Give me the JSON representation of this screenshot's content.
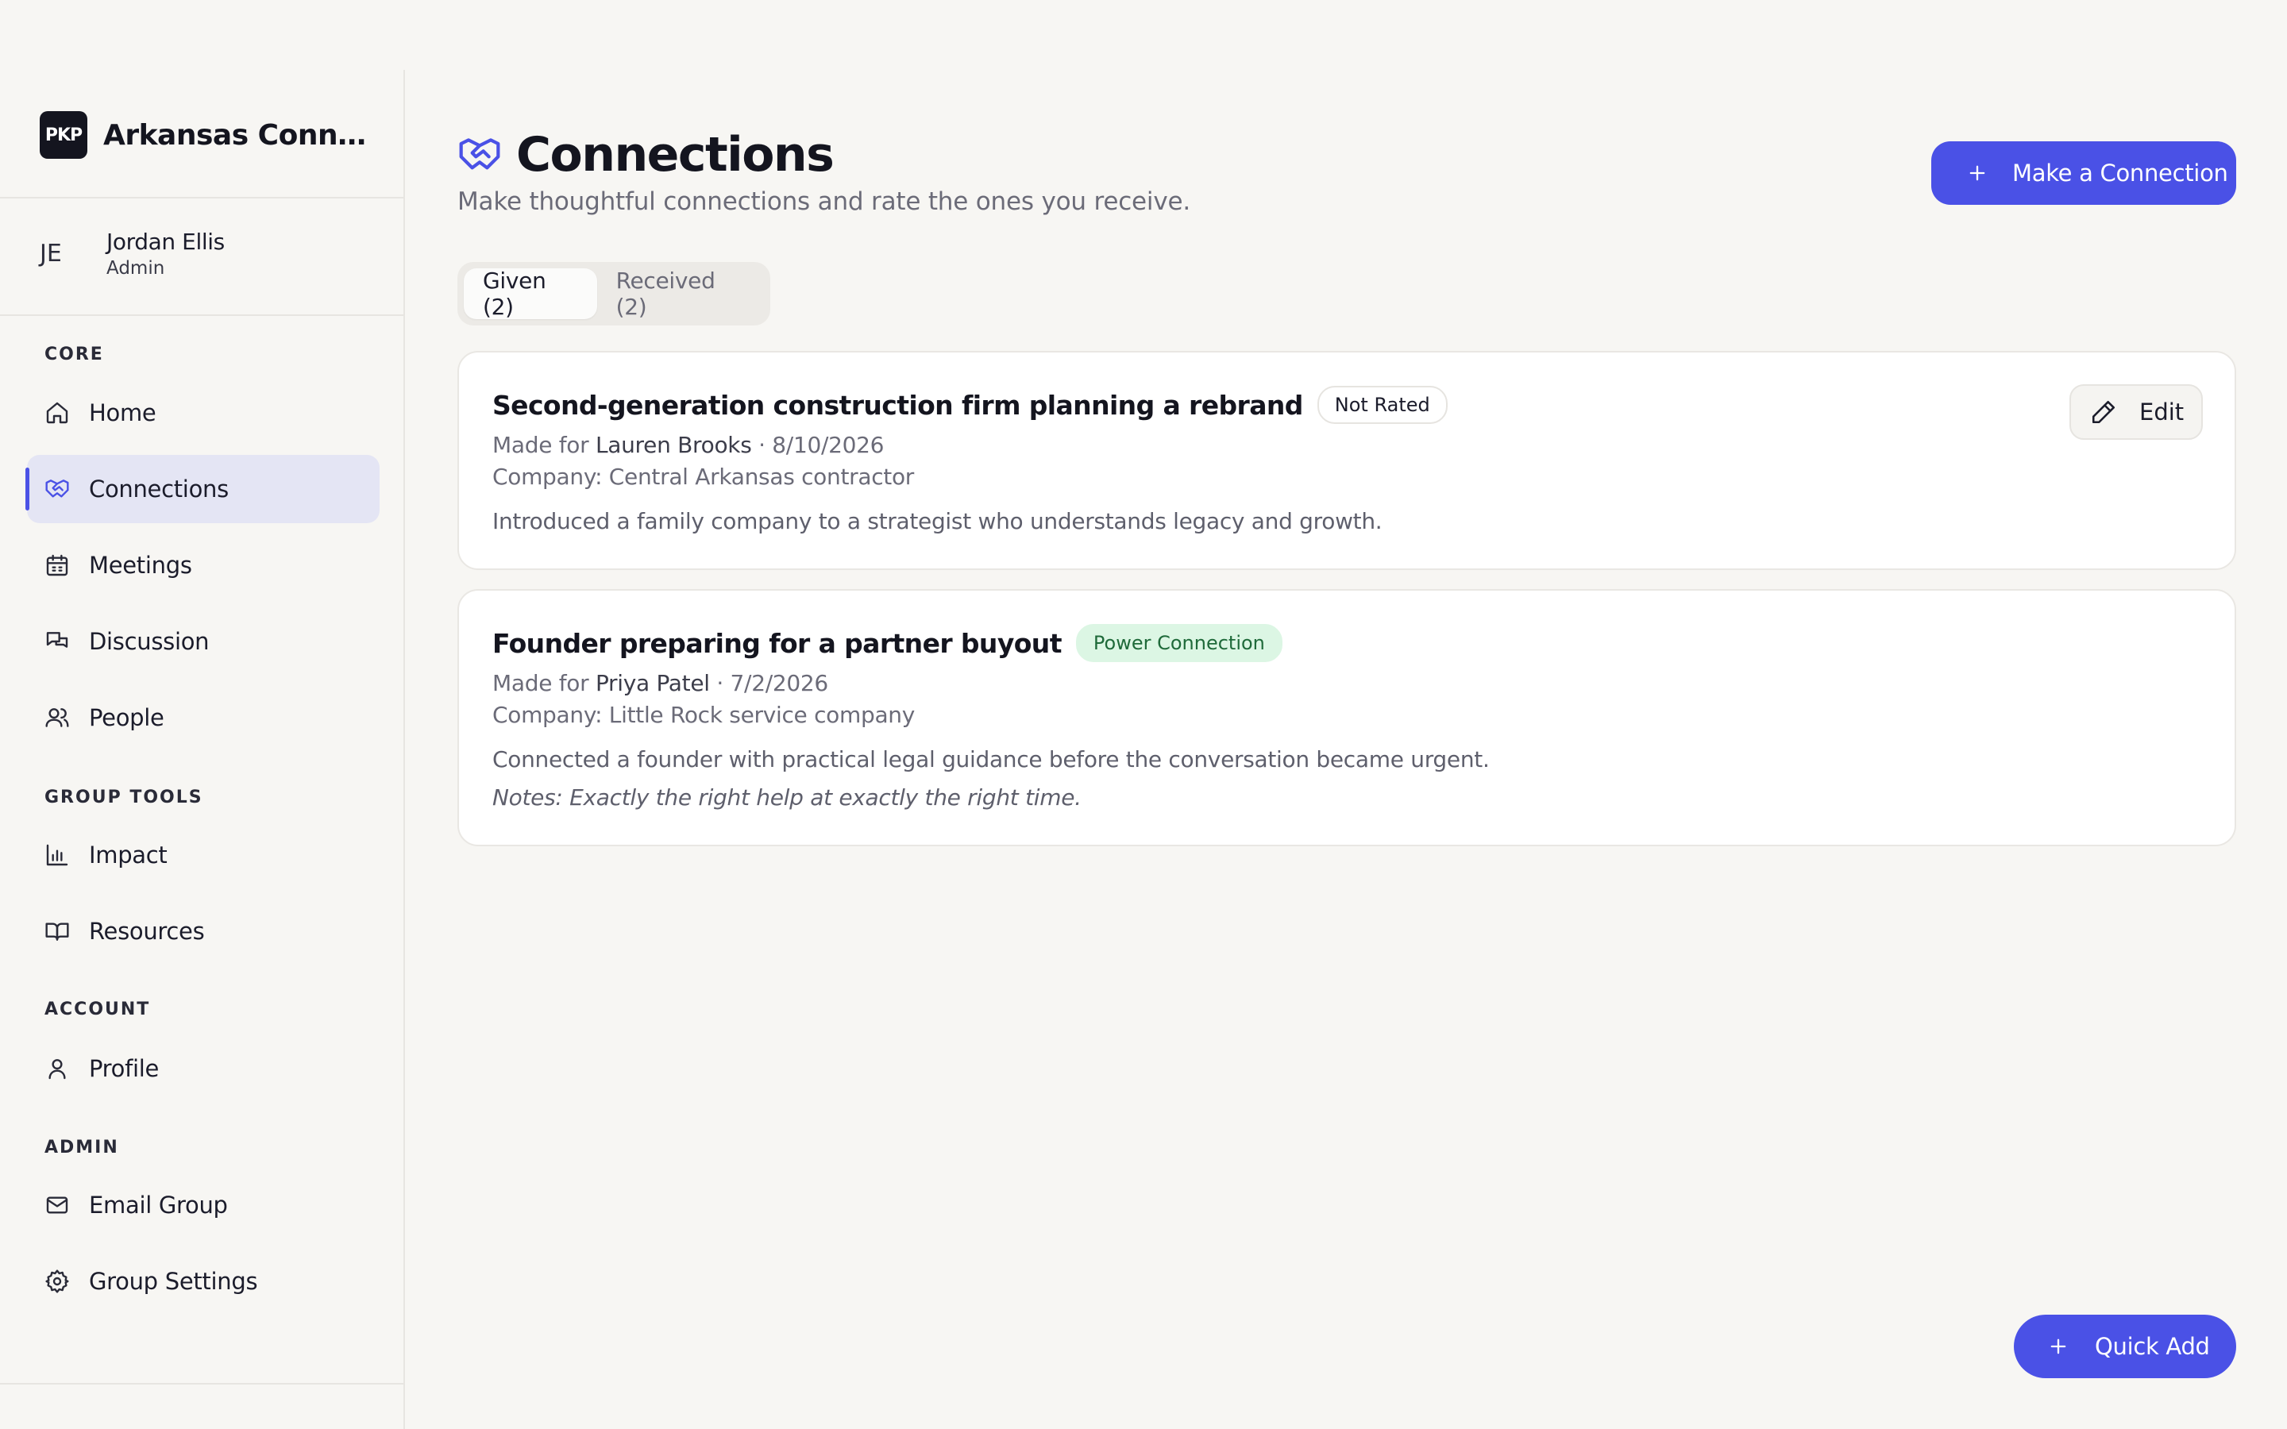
{
  "colors": {
    "accent": "#4a51e6",
    "active_nav_bg": "#e4e5f4",
    "power_badge_bg": "#dcf6e4",
    "power_badge_text": "#1f6a3a"
  },
  "sidebar": {
    "brand": {
      "logo_text": "PKP",
      "name": "Arkansas Connections"
    },
    "user": {
      "initials": "JE",
      "name": "Jordan Ellis",
      "role": "Admin"
    },
    "sections": [
      {
        "label": "CORE",
        "items": [
          {
            "label": "Home",
            "icon": "home-icon"
          },
          {
            "label": "Connections",
            "icon": "handshake-icon",
            "active": true
          },
          {
            "label": "Meetings",
            "icon": "calendar-icon"
          },
          {
            "label": "Discussion",
            "icon": "chat-icon"
          },
          {
            "label": "People",
            "icon": "users-icon"
          }
        ]
      },
      {
        "label": "GROUP TOOLS",
        "items": [
          {
            "label": "Impact",
            "icon": "bar-chart-icon"
          },
          {
            "label": "Resources",
            "icon": "book-icon"
          }
        ]
      },
      {
        "label": "ACCOUNT",
        "items": [
          {
            "label": "Profile",
            "icon": "user-icon"
          }
        ]
      },
      {
        "label": "ADMIN",
        "items": [
          {
            "label": "Email Group",
            "icon": "mail-icon"
          },
          {
            "label": "Group Settings",
            "icon": "gear-icon"
          }
        ]
      }
    ]
  },
  "header": {
    "title": "Connections",
    "subtitle": "Make thoughtful connections and rate the ones you receive.",
    "primary_action": "Make a Connection"
  },
  "tabs": [
    {
      "label": "Given (2)",
      "active": true
    },
    {
      "label": "Received (2)",
      "active": false
    }
  ],
  "connections": [
    {
      "title": "Second-generation construction firm planning a rebrand",
      "badge": "Not Rated",
      "made_for_prefix": "Made for",
      "person": "Lauren Brooks",
      "date": "· 8/10/2026",
      "company": "Company: Central Arkansas contractor",
      "description": "Introduced a family company to a strategist who understands legacy and growth.",
      "edit_label": "Edit"
    },
    {
      "title": "Founder preparing for a partner buyout",
      "badge": "Power Connection",
      "made_for_prefix": "Made for",
      "person": "Priya Patel",
      "date": "· 7/2/2026",
      "company": "Company: Little Rock service company",
      "description": "Connected a founder with practical legal guidance before the conversation became urgent.",
      "notes": "Notes: Exactly the right help at exactly the right time."
    }
  ],
  "quick_add": "Quick Add"
}
